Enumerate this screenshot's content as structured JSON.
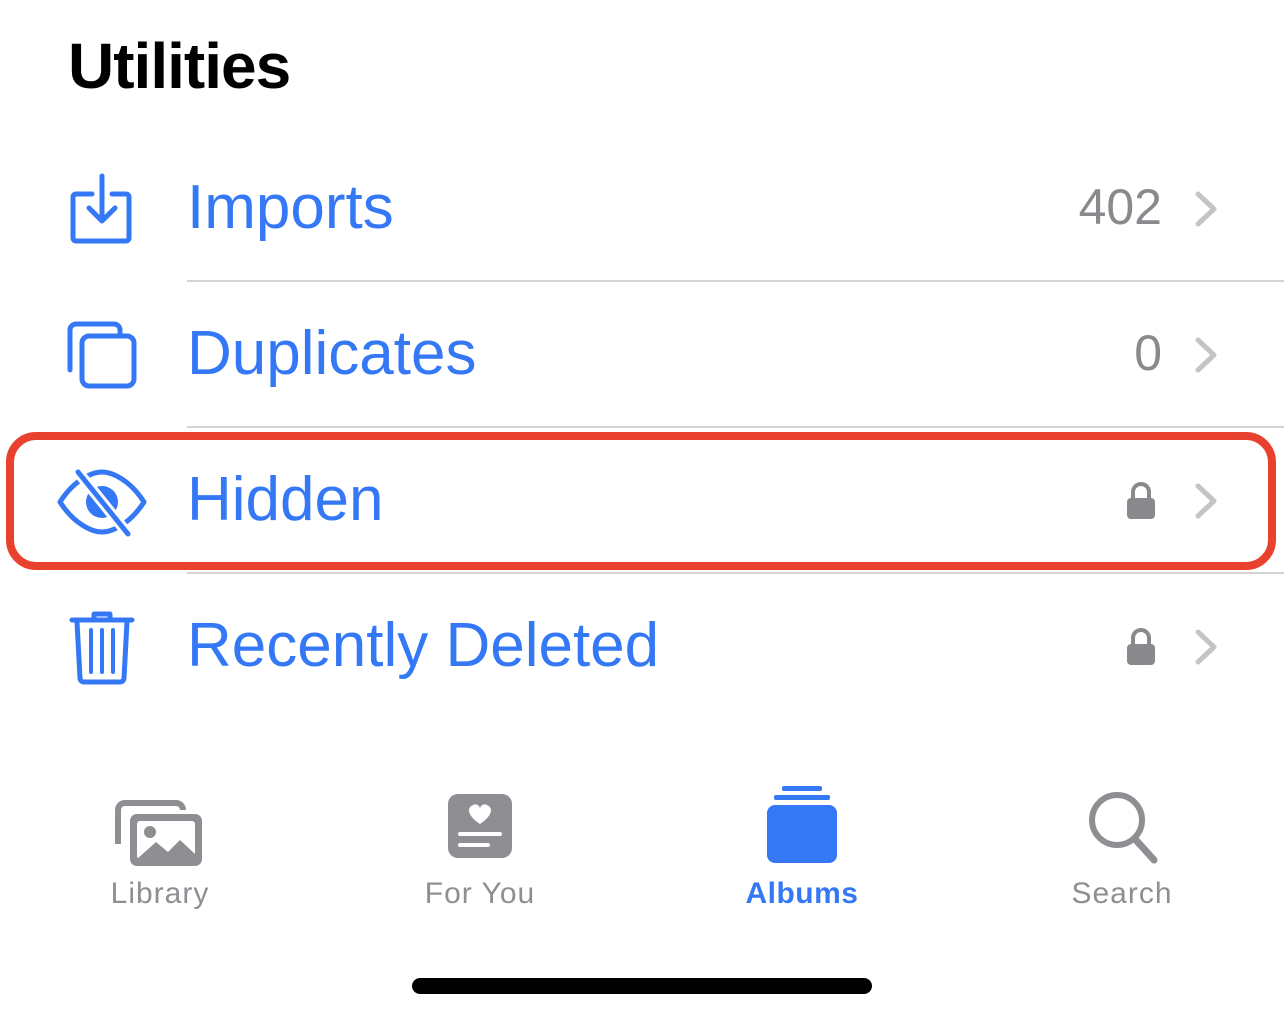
{
  "section": {
    "title": "Utilities"
  },
  "items": [
    {
      "label": "Imports",
      "count": "402",
      "icon": "tray-arrow-down-icon",
      "locked": false
    },
    {
      "label": "Duplicates",
      "count": "0",
      "icon": "duplicate-squares-icon",
      "locked": false
    },
    {
      "label": "Hidden",
      "count": "",
      "icon": "eye-slash-icon",
      "locked": true
    },
    {
      "label": "Recently Deleted",
      "count": "",
      "icon": "trash-icon",
      "locked": true
    }
  ],
  "tabbar": {
    "tabs": [
      {
        "label": "Library",
        "icon": "photos-stack-icon",
        "active": false
      },
      {
        "label": "For You",
        "icon": "heart-card-icon",
        "active": false
      },
      {
        "label": "Albums",
        "icon": "albums-stack-icon",
        "active": true
      },
      {
        "label": "Search",
        "icon": "magnifying-glass-icon",
        "active": false
      }
    ]
  },
  "colors": {
    "accent": "#3478f6",
    "secondary_text": "#8a8a8e",
    "highlight_outline": "#e8412d",
    "chevron": "#c4c4c7",
    "tab_inactive": "#8e8e93"
  }
}
